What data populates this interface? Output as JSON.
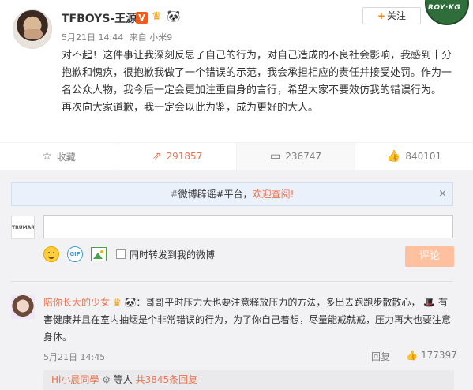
{
  "post": {
    "username": "TFBOYS-王源",
    "verified_icon": "V",
    "crown_icon": "crown-icon",
    "panda_icon": "panda-icon",
    "date": "5月21日 14:44",
    "source": "来自 小米9",
    "paragraphs": [
      "对不起！这件事让我深刻反思了自己的行为，对自己造成的不良社会影响，我感到十分抱歉和愧疚，很抱歉我做了一个错误的示范，我会承担相应的责任并接受处罚。作为一名公众人物，我今后一定会更加注重自身的言行，希望大家不要效仿我的错误行为。",
      "再次向大家道歉，我一定会以此为鉴，成为更好的大人。"
    ],
    "follow_label": "关注",
    "follow_plus": "+",
    "corner_logo_text": "ROY·KG"
  },
  "actions": {
    "collect": {
      "icon": "star-icon",
      "label": "收藏"
    },
    "repost": {
      "icon": "repost-icon",
      "count": "291857"
    },
    "comment": {
      "icon": "comment-icon",
      "count": "236747"
    },
    "like": {
      "icon": "thumb-up-icon",
      "count": "840101"
    }
  },
  "notice": {
    "prefix": "#",
    "text": "微博辟谣#平台，",
    "link": "欢迎查阅!",
    "close": "×"
  },
  "composer": {
    "avatar_text": "TRUMARE",
    "input_value": "",
    "repost_label": "同时转发到我的微博",
    "gif_label": "GIF",
    "submit_label": "评论"
  },
  "comment": {
    "name": "陪你长大的少女",
    "text_main": "：哥哥平时压力大也要注意释放压力的方法，多出去跑跑步散散心，",
    "text_tail": " 有害健康并且在室内抽烟是个非常错误的行为，为了你自己着想，尽量能戒就戒，压力再大也要注意身体。",
    "inline_emoji": "hat-icon",
    "time": "5月21日 14:45",
    "reply_label": "回复",
    "like_count": "177397"
  },
  "sub_replies": {
    "name": "Hi小晨同學",
    "middle": "等人",
    "count_text": "共3845条回复",
    "medal_icon": "medal-icon"
  },
  "colors": {
    "accent": "#eb7350",
    "notice_bg": "#eaf1fb",
    "comment_bg": "#f2f2f5",
    "submit_disabled": "#ffc09f"
  }
}
